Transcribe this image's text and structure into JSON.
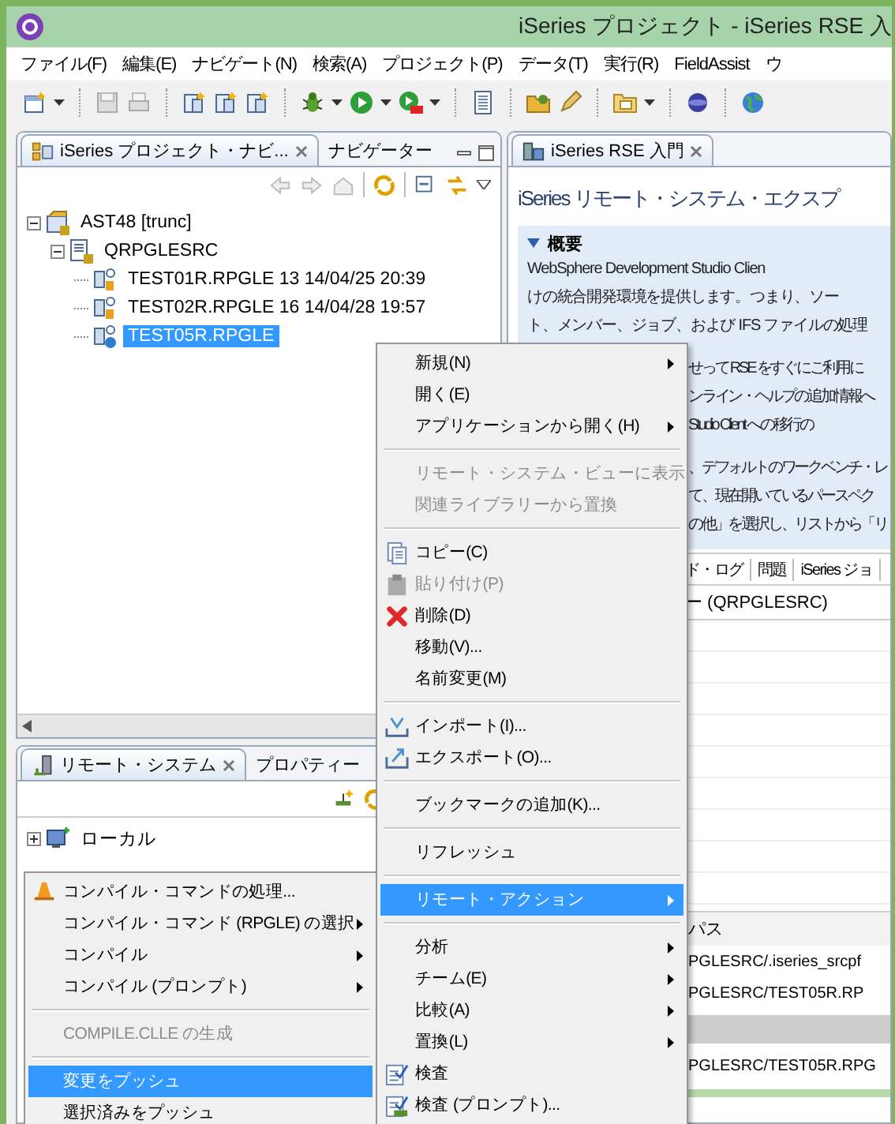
{
  "window": {
    "title": "iSeries プロジェクト - iSeries RSE 入"
  },
  "menubar": [
    "ファイル(F)",
    "編集(E)",
    "ナビゲート(N)",
    "検索(A)",
    "プロジェクト(P)",
    "データ(T)",
    "実行(R)",
    "FieldAssist",
    "ウ"
  ],
  "project_navigator": {
    "tabs": [
      {
        "label": "iSeries プロジェクト・ナビ...",
        "selected": true
      },
      {
        "label": "ナビゲーター",
        "selected": false
      }
    ],
    "tree": [
      {
        "label": "AST48 [trunc]",
        "expanded": true,
        "selected": false,
        "children": [
          {
            "label": "QRPGLESRC",
            "expanded": true,
            "selected": false,
            "children": [
              {
                "label": "TEST01R.RPGLE 13  14/04/25 20:39",
                "selected": false
              },
              {
                "label": "TEST02R.RPGLE 16  14/04/28 19:57",
                "selected": false
              },
              {
                "label": "TEST05R.RPGLE",
                "selected": true
              }
            ]
          }
        ]
      }
    ]
  },
  "remote_systems": {
    "tabs": [
      {
        "label": "リモート・システム",
        "selected": true
      },
      {
        "label": "プロパティー",
        "selected": false
      }
    ],
    "tree": [
      {
        "label": "ローカル",
        "expanded": false,
        "selected": false
      }
    ]
  },
  "rse_intro": {
    "tab": {
      "label": "iSeries RSE 入門",
      "selected": true
    },
    "heading": "iSeries リモート・システム・エクスプ",
    "section": {
      "title": "概要",
      "expanded": true,
      "lines": [
        "WebSphere Development Studio Clien",
        "けの統合開発環境を提供します。つまり、ソー",
        "ト、メンバー、ジョブ、および IFS ファイルの処理"
      ],
      "partial_paragraphs": [
        [
          "せって RSE をすぐにご利用に",
          "ンライン・ヘルプの追加情報へ",
          "Studio Client への移行の"
        ],
        [
          "、デフォルトのワークベンチ・レ",
          "て、現在開いているパースペク",
          "の他」を選択し、リストから「リ"
        ]
      ]
    },
    "view_tabs": [
      "ド・ログ",
      "問題",
      "iSeries ジョ"
    ],
    "view_title": "ー (QRPGLESRC)",
    "table_header": "パス",
    "table_rows": [
      "PGLESRC/.iseries_srcpf",
      "PGLESRC/TEST05R.RP"
    ],
    "bottom_row": "PGLESRC/TEST05R.RPG"
  },
  "context_menu": {
    "items": [
      {
        "kind": "item",
        "label": "新規(N)",
        "submenu": true,
        "disabled": false,
        "selected": false
      },
      {
        "kind": "item",
        "label": "開く(E)",
        "submenu": false,
        "disabled": false,
        "selected": false
      },
      {
        "kind": "item",
        "label": "アプリケーションから開く(H)",
        "submenu": true,
        "disabled": false,
        "selected": false
      },
      {
        "kind": "separator"
      },
      {
        "kind": "item",
        "label": "リモート・システム・ビューに表示",
        "submenu": false,
        "disabled": true,
        "selected": false
      },
      {
        "kind": "item",
        "label": "関連ライブラリーから置換",
        "submenu": false,
        "disabled": true,
        "selected": false
      },
      {
        "kind": "separator"
      },
      {
        "kind": "item",
        "label": "コピー(C)",
        "submenu": false,
        "disabled": false,
        "selected": false
      },
      {
        "kind": "item",
        "label": "貼り付け(P)",
        "submenu": false,
        "disabled": true,
        "selected": false
      },
      {
        "kind": "item",
        "label": "削除(D)",
        "submenu": false,
        "disabled": false,
        "selected": false
      },
      {
        "kind": "item",
        "label": "移動(V)...",
        "submenu": false,
        "disabled": false,
        "selected": false
      },
      {
        "kind": "item",
        "label": "名前変更(M)",
        "submenu": false,
        "disabled": false,
        "selected": false
      },
      {
        "kind": "separator"
      },
      {
        "kind": "item",
        "label": "インポート(I)...",
        "submenu": false,
        "disabled": false,
        "selected": false
      },
      {
        "kind": "item",
        "label": "エクスポート(O)...",
        "submenu": false,
        "disabled": false,
        "selected": false
      },
      {
        "kind": "separator"
      },
      {
        "kind": "item",
        "label": "ブックマークの追加(K)...",
        "submenu": false,
        "disabled": false,
        "selected": false
      },
      {
        "kind": "separator"
      },
      {
        "kind": "item",
        "label": "リフレッシュ",
        "submenu": false,
        "disabled": false,
        "selected": false
      },
      {
        "kind": "separator"
      },
      {
        "kind": "item",
        "label": "リモート・アクション",
        "submenu": true,
        "disabled": false,
        "selected": true
      },
      {
        "kind": "separator"
      },
      {
        "kind": "item",
        "label": "分析",
        "submenu": true,
        "disabled": false,
        "selected": false
      },
      {
        "kind": "item",
        "label": "チーム(E)",
        "submenu": true,
        "disabled": false,
        "selected": false
      },
      {
        "kind": "item",
        "label": "比較(A)",
        "submenu": true,
        "disabled": false,
        "selected": false
      },
      {
        "kind": "item",
        "label": "置換(L)",
        "submenu": true,
        "disabled": false,
        "selected": false
      },
      {
        "kind": "item",
        "label": "検査",
        "submenu": false,
        "disabled": false,
        "selected": false
      },
      {
        "kind": "item",
        "label": "検査 (プロンプト)...",
        "submenu": false,
        "disabled": false,
        "selected": false
      }
    ]
  },
  "submenu": {
    "items": [
      {
        "kind": "item",
        "label": "コンパイル・コマンドの処理...",
        "submenu": false,
        "disabled": false,
        "selected": false
      },
      {
        "kind": "item",
        "label": "コンパイル・コマンド (RPGLE) の選択",
        "submenu": true,
        "disabled": false,
        "selected": false
      },
      {
        "kind": "item",
        "label": "コンパイル",
        "submenu": true,
        "disabled": false,
        "selected": false
      },
      {
        "kind": "item",
        "label": "コンパイル (プロンプト)",
        "submenu": true,
        "disabled": false,
        "selected": false
      },
      {
        "kind": "separator"
      },
      {
        "kind": "item",
        "label": "COMPILE.CLLE の生成",
        "submenu": false,
        "disabled": true,
        "selected": false
      },
      {
        "kind": "separator"
      },
      {
        "kind": "item",
        "label": "変更をプッシュ",
        "submenu": false,
        "disabled": false,
        "selected": true
      },
      {
        "kind": "item",
        "label": "選択済みをプッシュ",
        "submenu": false,
        "disabled": false,
        "selected": false
      }
    ]
  }
}
